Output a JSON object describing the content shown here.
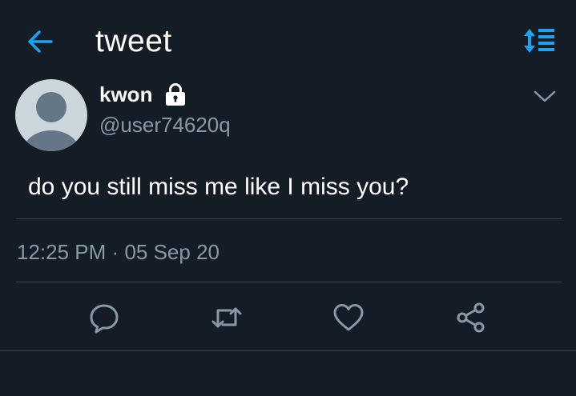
{
  "header": {
    "title": "tweet",
    "back_icon": "arrow-left-icon",
    "sort_icon": "sort-options-icon"
  },
  "tweet": {
    "author": {
      "display_name": "kwon",
      "handle": "@user74620q",
      "protected_icon": "lock-icon",
      "avatar_icon": "default-avatar-icon"
    },
    "menu_icon": "chevron-down-icon",
    "text": "do you still miss me like I miss you?",
    "time": "12:25 PM",
    "separator": "·",
    "date": "05 Sep 20",
    "actions": [
      {
        "name": "reply",
        "icon": "reply-icon"
      },
      {
        "name": "retweet",
        "icon": "retweet-icon"
      },
      {
        "name": "like",
        "icon": "heart-icon"
      },
      {
        "name": "share",
        "icon": "share-icon"
      }
    ]
  },
  "colors": {
    "background": "#141d26",
    "accent": "#1da1f2",
    "secondary_text": "#8899a6",
    "divider": "#38444d",
    "avatar_bg": "#ccd6dd",
    "avatar_fg": "#657786"
  }
}
